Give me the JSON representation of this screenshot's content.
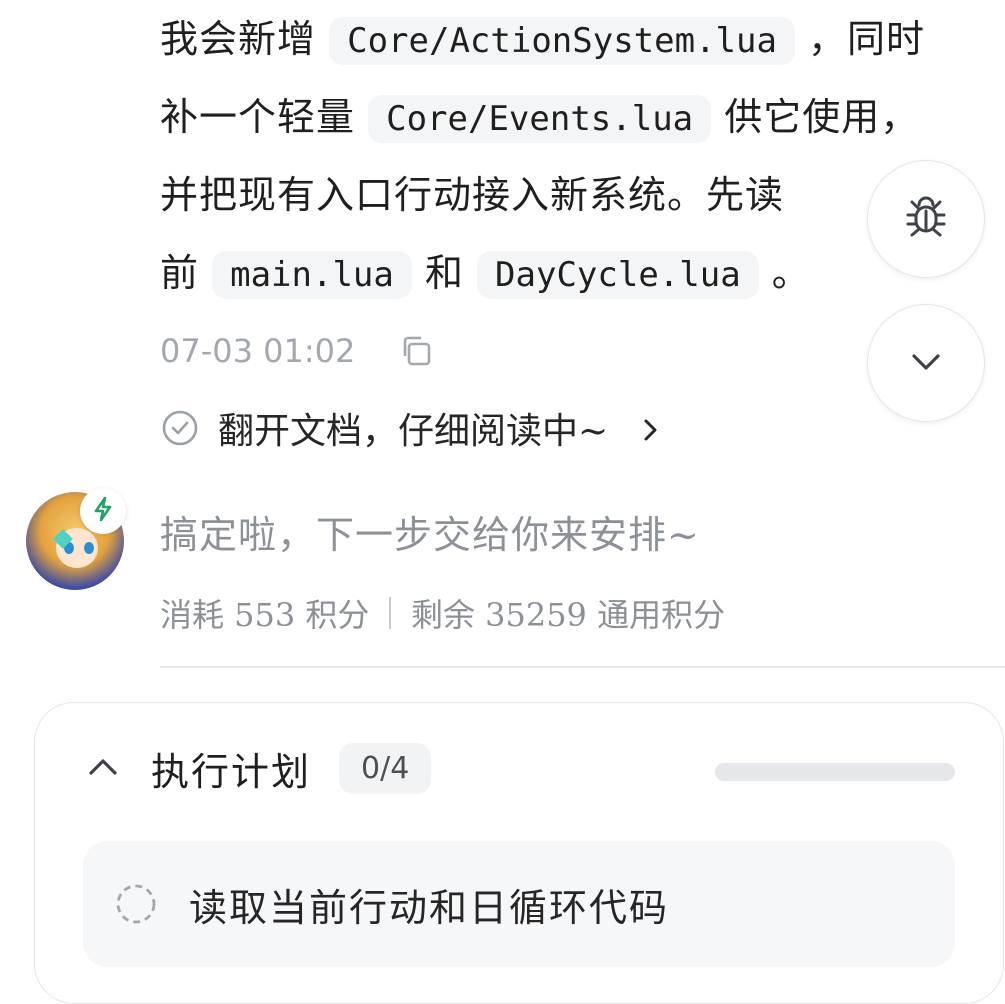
{
  "message": {
    "line1": {
      "pre": "我会新增 ",
      "code": "Core/ActionSystem.lua",
      "post": " ，同时"
    },
    "line2": {
      "pre": "补一个轻量 ",
      "code": "Core/Events.lua",
      "post": " 供它使用，"
    },
    "line3": {
      "text": "并把现有入口行动接入新系统。先读"
    },
    "line4": {
      "pre": "前 ",
      "code1": "main.lua",
      "mid": " 和 ",
      "code2": "DayCycle.lua",
      "post": " 。"
    }
  },
  "meta": {
    "timestamp": "07-03 01:02",
    "copy_icon": "copy-icon"
  },
  "reading_status": {
    "label": "翻开文档，仔细阅读中~",
    "icon": "check-circle-icon"
  },
  "fabs": {
    "debug_icon": "bug-icon",
    "scroll_icon": "chevron-down-icon"
  },
  "assistant": {
    "status_text": "搞定啦，下一步交给你来安排~",
    "usage_consumed": "消耗 553 积分",
    "usage_remaining": "剩余 35259 通用积分"
  },
  "plan": {
    "title": "执行计划",
    "count": "0/4",
    "progress": 0,
    "tasks": [
      {
        "label": "读取当前行动和日循环代码",
        "status": "pending"
      }
    ]
  },
  "colors": {
    "accent": "#3b82f6",
    "badge_green": "#22a06b",
    "muted": "#8c9097"
  }
}
